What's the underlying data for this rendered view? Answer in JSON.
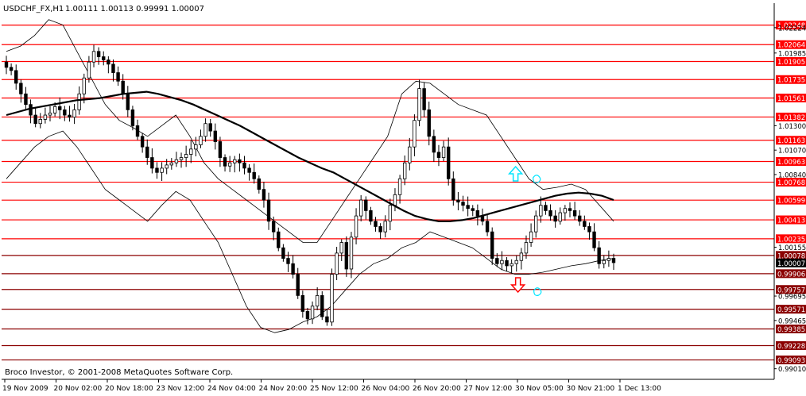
{
  "header": {
    "symbol_label": "USDCHF_FX,H1",
    "ohlc_label": "1.00111 1.00113 0.99991 1.00007"
  },
  "footer": {
    "copyright": "Broco Investor, © 2001-2008 MetaQuotes Software Corp."
  },
  "colors": {
    "background": "#ffffff",
    "candles": "#000000",
    "red_lines": "#ff0000",
    "dark_red_lines": "#8b0000",
    "buy_arrow": "#00e5ff",
    "sell_arrow": "#ff0000",
    "current_price_bg": "#000000"
  },
  "chart_data": {
    "type": "candlestick",
    "ylim": [
      0.99,
      1.0235
    ],
    "x_ticks": [
      "19 Nov 2009",
      "20 Nov 02:00",
      "20 Nov 18:00",
      "23 Nov 12:00",
      "24 Nov 04:00",
      "24 Nov 20:00",
      "25 Nov 12:00",
      "26 Nov 04:00",
      "26 Nov 20:00",
      "27 Nov 12:00",
      "30 Nov 05:00",
      "30 Nov 21:00",
      "1 Dec 13:00"
    ],
    "y_ticks": [
      "1.02224",
      "1.01985",
      "1.01300",
      "1.01070",
      "1.00840",
      "1.00155",
      "0.99695",
      "0.99465",
      "0.99010"
    ],
    "levels_red": [
      "1.02248",
      "1.02064",
      "1.01905",
      "1.01735",
      "1.01561",
      "1.01382",
      "1.01163",
      "1.00963",
      "1.00768",
      "1.00599",
      "1.00413",
      "1.00235"
    ],
    "levels_dark": [
      "1.00078",
      "0.99906",
      "0.99757",
      "0.99571",
      "0.99385",
      "0.99228",
      "0.99093"
    ],
    "current_price": "1.00007",
    "close_path": [
      1.0185,
      1.0182,
      1.017,
      1.016,
      1.015,
      1.014,
      1.0132,
      1.0136,
      1.014,
      1.0142,
      1.0148,
      1.0145,
      1.014,
      1.0138,
      1.0145,
      1.016,
      1.0175,
      1.019,
      1.02,
      1.0195,
      1.0192,
      1.0188,
      1.018,
      1.0172,
      1.016,
      1.0145,
      1.013,
      1.012,
      1.011,
      1.01,
      1.009,
      1.0086,
      1.009,
      1.0093,
      1.0095,
      1.0098,
      1.01,
      1.0103,
      1.0108,
      1.0112,
      1.012,
      1.0132,
      1.0125,
      1.0115,
      1.01,
      1.0092,
      1.0095,
      1.0098,
      1.0095,
      1.009,
      1.0086,
      1.008,
      1.007,
      1.006,
      1.004,
      1.003,
      1.0015,
      1.0005,
      1.0,
      0.999,
      0.997,
      0.9955,
      0.9948,
      0.996,
      0.997,
      0.995,
      0.9945,
      0.999,
      1.001,
      1.002,
      0.9995,
      1.0025,
      1.0045,
      1.006,
      1.005,
      1.004,
      1.0035,
      1.003,
      1.004,
      1.0055,
      1.0065,
      1.008,
      1.0095,
      1.011,
      1.0135,
      1.0165,
      1.0145,
      1.012,
      1.0105,
      1.01,
      1.011,
      1.008,
      1.006,
      1.0058,
      1.0055,
      1.0052,
      1.005,
      1.0045,
      1.004,
      1.003,
      1.0005,
      1.0,
      1.0003,
      0.9998,
      1.0,
      1.0003,
      1.001,
      1.002,
      1.003,
      1.0045,
      1.0055,
      1.005,
      1.0045,
      1.004,
      1.0048,
      1.0052,
      1.005,
      1.0045,
      1.004,
      1.0035,
      1.003,
      1.0015,
      1.0,
      1.0003,
      1.0005,
      1.0001
    ],
    "ma_path": [
      1.014,
      1.0143,
      1.0146,
      1.0148,
      1.015,
      1.0152,
      1.0154,
      1.0155,
      1.0156,
      1.0158,
      1.016,
      1.0161,
      1.0162,
      1.016,
      1.0157,
      1.0154,
      1.015,
      1.0145,
      1.014,
      1.0135,
      1.013,
      1.0124,
      1.0118,
      1.0112,
      1.0106,
      1.01,
      1.0095,
      1.009,
      1.0086,
      1.008,
      1.0074,
      1.0068,
      1.0062,
      1.0056,
      1.005,
      1.0045,
      1.0042,
      1.004,
      1.004,
      1.0041,
      1.0043,
      1.0046,
      1.0049,
      1.0052,
      1.0055,
      1.0058,
      1.0061,
      1.0064,
      1.0066,
      1.0067,
      1.0066,
      1.0064,
      1.006
    ],
    "ma_start_index": 0,
    "ma_end_index": 125,
    "upper_band": [
      1.02,
      1.0205,
      1.0215,
      1.023,
      1.0225,
      1.02,
      1.0175,
      1.015,
      1.0135,
      1.0128,
      1.012,
      1.013,
      1.014,
      1.012,
      1.0095,
      1.008,
      1.007,
      1.006,
      1.005,
      1.004,
      1.003,
      1.002,
      1.002,
      1.004,
      1.006,
      1.008,
      1.01,
      1.012,
      1.016,
      1.0172,
      1.017,
      1.016,
      1.015,
      1.0145,
      1.014,
      1.012,
      1.01,
      1.008,
      1.007,
      1.0072,
      1.0075,
      1.007,
      1.0055,
      1.004
    ],
    "lower_band": [
      1.008,
      1.0095,
      1.011,
      1.012,
      1.0125,
      1.011,
      1.009,
      1.007,
      1.006,
      1.005,
      1.004,
      1.0055,
      1.0068,
      1.006,
      1.004,
      1.002,
      0.999,
      0.996,
      0.994,
      0.9935,
      0.9938,
      0.9945,
      0.995,
      0.996,
      0.9975,
      0.999,
      1.0,
      1.0005,
      1.0015,
      1.002,
      1.003,
      1.0025,
      1.002,
      1.0015,
      1.0005,
      0.9995,
      0.999,
      0.999,
      0.9992,
      0.9995,
      0.9998,
      1.0,
      1.0003,
      1.0005
    ],
    "buy_marker_x_index": 104,
    "sell_marker_x_index": 104
  }
}
